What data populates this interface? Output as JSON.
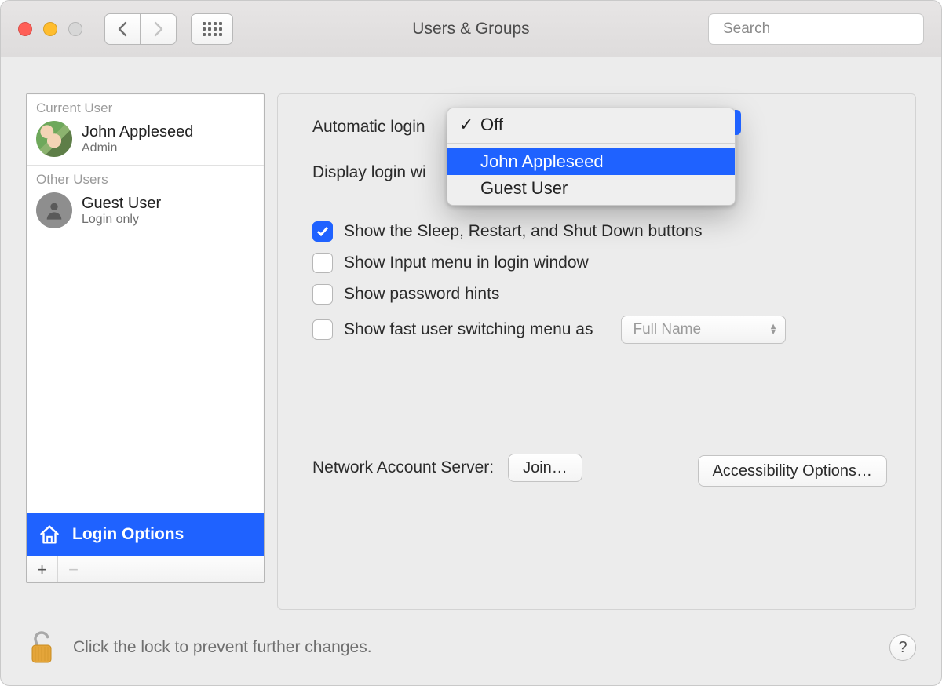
{
  "window": {
    "title": "Users & Groups"
  },
  "search": {
    "placeholder": "Search",
    "value": ""
  },
  "sidebar": {
    "sections": {
      "current_label": "Current User",
      "other_label": "Other Users"
    },
    "current_user": {
      "name": "John Appleseed",
      "role": "Admin"
    },
    "other_users": [
      {
        "name": "Guest User",
        "role": "Login only"
      }
    ],
    "login_options_label": "Login Options"
  },
  "main": {
    "automatic_login_label": "Automatic login",
    "display_login_label": "Display login wi",
    "checks": {
      "show_sleep": {
        "label": "Show the Sleep, Restart, and Shut Down buttons",
        "checked": true
      },
      "show_input": {
        "label": "Show Input menu in login window",
        "checked": false
      },
      "show_hints": {
        "label": "Show password hints",
        "checked": false
      },
      "fast_user": {
        "label": "Show fast user switching menu as",
        "checked": false
      }
    },
    "fast_user_select": "Full Name",
    "accessibility_button": "Accessibility Options…",
    "network_label": "Network Account Server:",
    "join_button": "Join…"
  },
  "dropdown": {
    "options": [
      {
        "label": "Off",
        "checked": true,
        "highlight": false
      },
      {
        "label": "John Appleseed",
        "checked": false,
        "highlight": true
      },
      {
        "label": "Guest User",
        "checked": false,
        "highlight": false
      }
    ]
  },
  "footer": {
    "lock_text": "Click the lock to prevent further changes."
  }
}
